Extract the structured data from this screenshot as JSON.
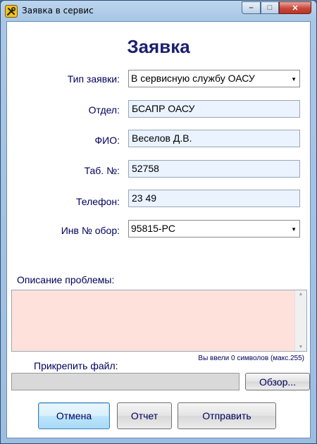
{
  "window": {
    "title": "Заявка в сервис",
    "controls": {
      "minimize": "–",
      "maximize": "□",
      "close": "✕"
    }
  },
  "form": {
    "heading": "Заявка",
    "fields": {
      "request_type": {
        "label": "Тип заявки:",
        "value": "В сервисную службу ОАСУ"
      },
      "department": {
        "label": "Отдел:",
        "value": "БСАПР ОАСУ"
      },
      "full_name": {
        "label": "ФИО:",
        "value": "Веселов Д.В."
      },
      "tab_number": {
        "label": "Таб. №:",
        "value": "52758"
      },
      "phone": {
        "label": "Телефон:",
        "value": "23 49"
      },
      "equipment_number": {
        "label": "Инв № обор:",
        "value": "95815-PC"
      }
    },
    "description": {
      "label": "Описание проблемы:",
      "value": "",
      "counter": "Вы ввели 0 символов (макс.255)"
    },
    "attachment": {
      "label": "Прикрепить файл:",
      "value": "",
      "browse_label": "Обзор..."
    },
    "buttons": {
      "cancel": "Отмена",
      "report": "Отчет",
      "send": "Отправить"
    }
  },
  "colors": {
    "accent_text": "#00005c",
    "heading": "#1c1f6e",
    "description_bg": "#ffe1dc",
    "input_bg": "#eaf3ff"
  },
  "icons": {
    "app": "tools-icon",
    "combo_arrow": "chevron-down-icon"
  }
}
